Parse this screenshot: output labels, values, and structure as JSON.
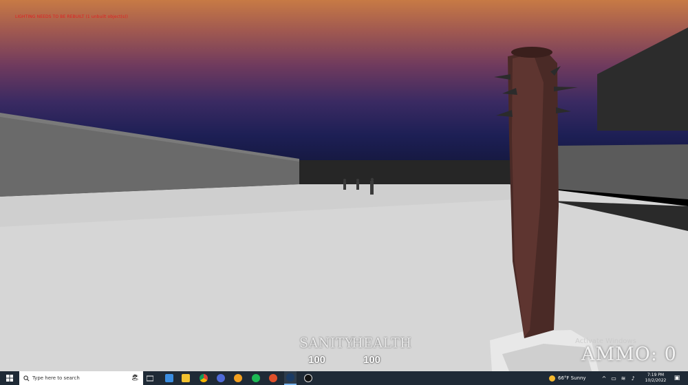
{
  "debug_message": "LIGHTING NEEDS TO BE REBUILT (1 unbuilt object(s))",
  "hud": {
    "sanity_label": "SANITY",
    "sanity_value": "100",
    "health_label": "HEALTH",
    "health_value": "100",
    "ammo_text": "AMMO: 0"
  },
  "watermark": "Activate Windows",
  "taskbar": {
    "search_placeholder": "Type here to search",
    "weather": "66°F  Sunny",
    "time": "7:19 PM",
    "date": "10/2/2022",
    "apps": [
      "task-view",
      "explorer-app",
      "file-explorer",
      "chrome",
      "app-blue",
      "app-orange",
      "spotify",
      "app-red",
      "steam",
      "unreal-engine"
    ]
  },
  "colors": {
    "sky_top": "#c77a45",
    "sky_bottom": "#15183f",
    "floor": "#d9d9d9",
    "hud_text": "#e9e9e9",
    "debug_text": "#e02020",
    "taskbar": "#1f2a36"
  }
}
